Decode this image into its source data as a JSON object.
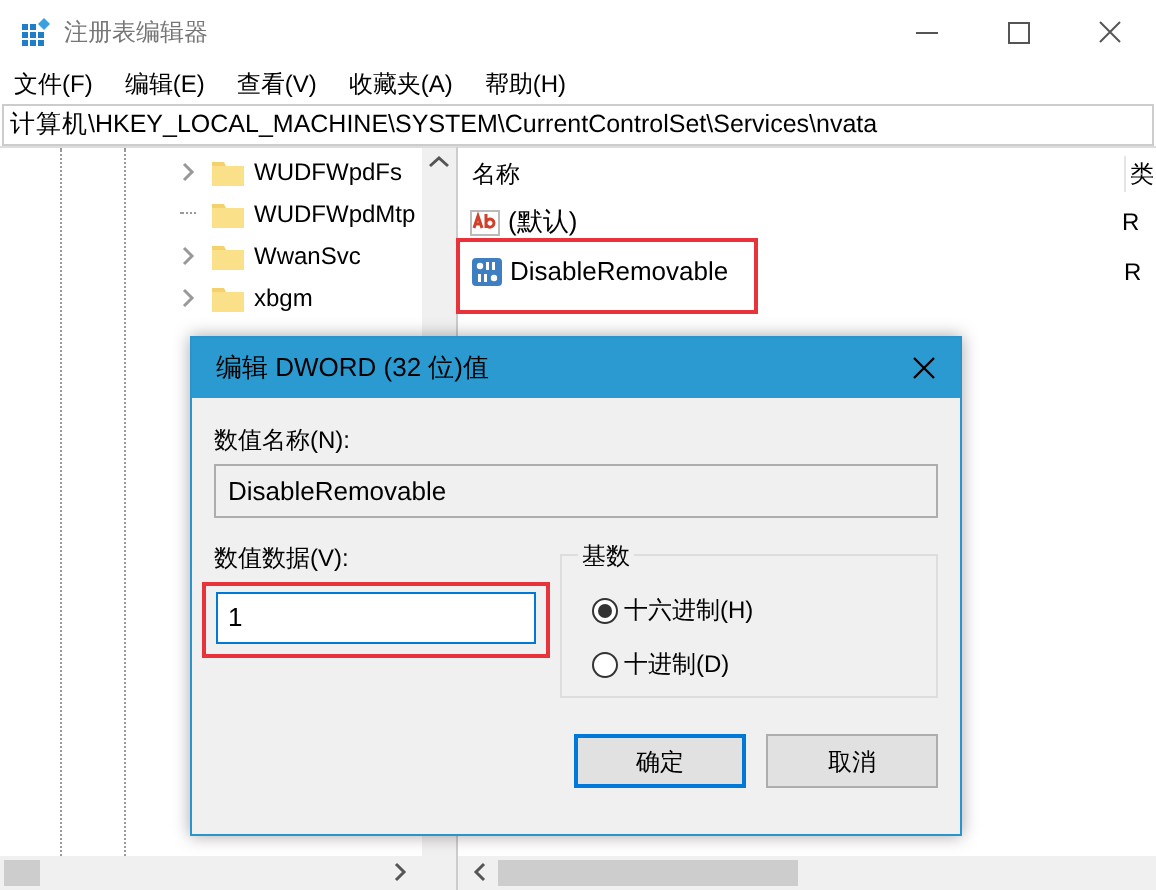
{
  "window": {
    "title": "注册表编辑器"
  },
  "menu": [
    "文件(F)",
    "编辑(E)",
    "查看(V)",
    "收藏夹(A)",
    "帮助(H)"
  ],
  "address": "计算机\\HKEY_LOCAL_MACHINE\\SYSTEM\\CurrentControlSet\\Services\\nvata",
  "tree": [
    {
      "label": "WUDFWpdFs",
      "expandable": true
    },
    {
      "label": "WUDFWpdMtp",
      "expandable": false
    },
    {
      "label": "WwanSvc",
      "expandable": true
    },
    {
      "label": "xbgm",
      "expandable": true
    }
  ],
  "list": {
    "columns": [
      "名称",
      "类"
    ],
    "rows": [
      {
        "kind": "string",
        "name": "(默认)",
        "column_2": "R",
        "highlighted": false
      },
      {
        "kind": "dword",
        "name": "DisableRemovable",
        "column_2": "R",
        "highlighted": true
      }
    ]
  },
  "dialog": {
    "title": "编辑 DWORD (32 位)值",
    "name_label": "数值名称(N):",
    "name_value": "DisableRemovable",
    "data_label": "数值数据(V):",
    "data_value": "1",
    "data_highlighted": true,
    "base_label": "基数",
    "radios": [
      {
        "label": "十六进制(H)",
        "selected": true
      },
      {
        "label": "十进制(D)",
        "selected": false
      }
    ],
    "buttons": [
      {
        "label": "确定",
        "default": true
      },
      {
        "label": "取消",
        "default": false
      }
    ]
  }
}
